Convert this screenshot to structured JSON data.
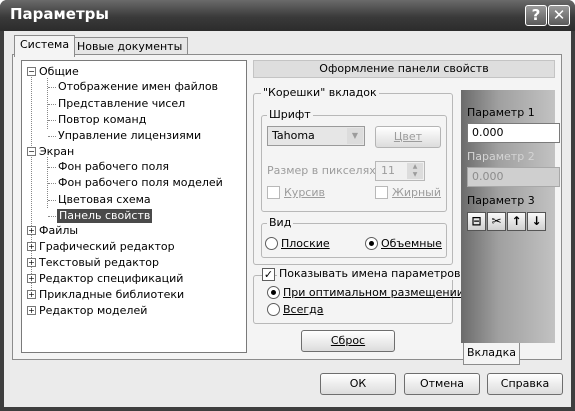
{
  "window": {
    "title": "Параметры",
    "help_label": "?",
    "close_label": "✕"
  },
  "tabs": [
    {
      "label": "Система"
    },
    {
      "label": "Новые документы"
    }
  ],
  "tree": {
    "obshie": {
      "label": "Общие",
      "toggle": "−"
    },
    "obshie_children": [
      "Отображение имен файлов",
      "Представление чисел",
      "Повтор команд",
      "Управление лицензиями"
    ],
    "ekran": {
      "label": "Экран",
      "toggle": "−"
    },
    "ekran_children": [
      "Фон рабочего поля",
      "Фон рабочего поля моделей",
      "Цветовая схема",
      "Панель свойств"
    ],
    "roots": [
      "Файлы",
      "Графический редактор",
      "Текстовый редактор",
      "Редактор спецификаций",
      "Прикладные библиотеки",
      "Редактор моделей"
    ],
    "plus": "+"
  },
  "panel": {
    "header": "Оформление панели свойств",
    "koreshki_group": "\"Корешки\" вкладок",
    "font_group": "Шрифт",
    "font_value": "Tahoma",
    "color_button": "Цвет",
    "size_label": "Размер в пикселях",
    "size_value": "11",
    "italic_label": "Курсив",
    "bold_label": "Жирный",
    "view_group": "Вид",
    "flat_label": "Плоские",
    "volume_label": "Объемные",
    "show_names_label": "Показывать имена параметров",
    "optimal_label": "При оптимальном размещении",
    "always_label": "Всегда",
    "reset_button": "Сброс"
  },
  "preview": {
    "param1_label": "Параметр 1",
    "param1_value": "0.000",
    "param2_label": "Параметр 2",
    "param2_value": "0.000",
    "param3_label": "Параметр 3",
    "tab_label": "Вкладка"
  },
  "footer": {
    "ok": "ОК",
    "cancel": "Отмена",
    "help": "Справка"
  }
}
